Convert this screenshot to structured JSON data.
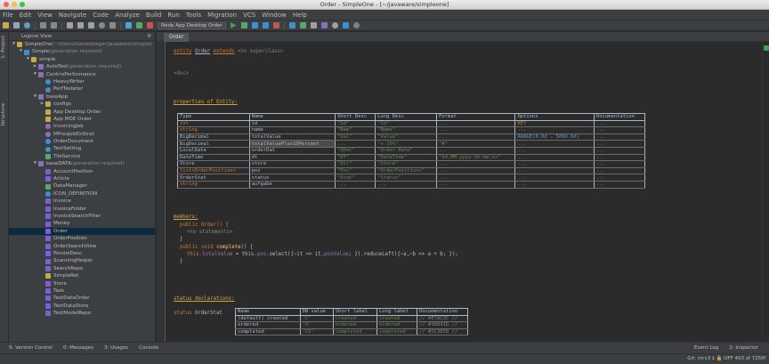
{
  "window": {
    "title": "Order - SimpleOne - [~/javaware/simpleone]"
  },
  "menu": [
    "File",
    "Edit",
    "View",
    "Navigate",
    "Code",
    "Analyze",
    "Build",
    "Run",
    "Tools",
    "Migration",
    "VCS",
    "Window",
    "Help"
  ],
  "toolbar": {
    "run_config": "Node App Desktop Order"
  },
  "left_stripe": {
    "project_tab": "1: Project",
    "structure_tab": "Structure"
  },
  "project_panel": {
    "header": "Logical View",
    "tree": [
      {
        "indent": 0,
        "arrow": "▼",
        "icon": "folder",
        "text": "SimpleOne",
        "note": " (~/Users/danielsteger/javaware/simpleo"
      },
      {
        "indent": 1,
        "arrow": "▼",
        "icon": "module",
        "text": "Simple",
        "note": " (generation required)"
      },
      {
        "indent": 2,
        "arrow": "▼",
        "icon": "folder",
        "text": "simple",
        "note": ""
      },
      {
        "indent": 3,
        "arrow": "▶",
        "icon": "pkg",
        "text": "AutoTest",
        "note": " (generation required)"
      },
      {
        "indent": 3,
        "arrow": "▼",
        "icon": "pkg",
        "text": "CentrixPerformance",
        "note": ""
      },
      {
        "indent": 4,
        "arrow": "",
        "icon": "class",
        "text": "HeavyWriter",
        "note": ""
      },
      {
        "indent": 4,
        "arrow": "",
        "icon": "class",
        "text": "PerfTesteter",
        "note": ""
      },
      {
        "indent": 3,
        "arrow": "▼",
        "icon": "pkg",
        "text": "baseApp",
        "note": ""
      },
      {
        "indent": 4,
        "arrow": "▶",
        "icon": "folder",
        "text": "configs",
        "note": ""
      },
      {
        "indent": 4,
        "arrow": "",
        "icon": "app",
        "text": "App Desktop Order",
        "note": ""
      },
      {
        "indent": 4,
        "arrow": "",
        "icon": "app",
        "text": "App MDE Order",
        "note": ""
      },
      {
        "indent": 4,
        "arrow": "",
        "icon": "job",
        "text": "InvoicingJob",
        "note": ""
      },
      {
        "indent": 4,
        "arrow": "",
        "icon": "job",
        "text": "MPresJobExStrat",
        "note": ""
      },
      {
        "indent": 4,
        "arrow": "",
        "icon": "class",
        "text": "OrderDocument",
        "note": ""
      },
      {
        "indent": 4,
        "arrow": "",
        "icon": "class",
        "text": "TextSetting",
        "note": ""
      },
      {
        "indent": 4,
        "arrow": "",
        "icon": "xml",
        "text": "TileService",
        "note": ""
      },
      {
        "indent": 3,
        "arrow": "▼",
        "icon": "pkg",
        "text": "baseDATA",
        "note": " (generation required)"
      },
      {
        "indent": 4,
        "arrow": "",
        "icon": "entity",
        "text": "AccountPosition",
        "note": ""
      },
      {
        "indent": 4,
        "arrow": "",
        "icon": "entity",
        "text": "Article",
        "note": ""
      },
      {
        "indent": 4,
        "arrow": "",
        "icon": "xml",
        "text": "DataManager",
        "note": ""
      },
      {
        "indent": 4,
        "arrow": "",
        "icon": "class",
        "text": "ICON_DEFINITION",
        "note": ""
      },
      {
        "indent": 4,
        "arrow": "",
        "icon": "entity",
        "text": "Invoice",
        "note": ""
      },
      {
        "indent": 4,
        "arrow": "",
        "icon": "entity",
        "text": "InvoiceFolder",
        "note": ""
      },
      {
        "indent": 4,
        "arrow": "",
        "icon": "entity",
        "text": "InvoiceSearchFilter",
        "note": ""
      },
      {
        "indent": 4,
        "arrow": "",
        "icon": "entity",
        "text": "Money",
        "note": ""
      },
      {
        "indent": 4,
        "arrow": "",
        "icon": "entity",
        "text": "Order",
        "note": "",
        "selected": true
      },
      {
        "indent": 4,
        "arrow": "",
        "icon": "entity",
        "text": "OrderPosition",
        "note": ""
      },
      {
        "indent": 4,
        "arrow": "",
        "icon": "entity",
        "text": "OrderSearchView",
        "note": ""
      },
      {
        "indent": 4,
        "arrow": "",
        "icon": "entity",
        "text": "PersistDesc",
        "note": ""
      },
      {
        "indent": 4,
        "arrow": "",
        "icon": "entity",
        "text": "ScanningHelper",
        "note": ""
      },
      {
        "indent": 4,
        "arrow": "",
        "icon": "entity",
        "text": "SearchRepo",
        "note": ""
      },
      {
        "indent": 4,
        "arrow": "",
        "icon": "folder",
        "text": "SimpleRet",
        "note": ""
      },
      {
        "indent": 4,
        "arrow": "",
        "icon": "entity",
        "text": "Store",
        "note": ""
      },
      {
        "indent": 4,
        "arrow": "",
        "icon": "entity",
        "text": "Task",
        "note": ""
      },
      {
        "indent": 4,
        "arrow": "",
        "icon": "entity",
        "text": "TextDataOrder",
        "note": ""
      },
      {
        "indent": 4,
        "arrow": "",
        "icon": "entity",
        "text": "TextDataStore",
        "note": ""
      },
      {
        "indent": 4,
        "arrow": "",
        "icon": "entity",
        "text": "TextModelRepo",
        "note": ""
      }
    ]
  },
  "editor": {
    "tab": "Order",
    "entity_line": {
      "kw": "entity",
      "name": "Order",
      "extends": "extends",
      "super": "<no superclass>"
    },
    "doc": "<doc>",
    "props_header": "properties of Entity:",
    "props_table": {
      "headers": [
        "Type",
        "Name",
        "Short Desc",
        "Long Desc",
        "Format",
        "Options",
        "Documentation"
      ],
      "rows": [
        [
          "int",
          "id",
          "\"Id\"",
          "\"Id\"",
          "...",
          "KEY",
          "..."
        ],
        [
          "string",
          "name",
          "\"Nam\"",
          "\"Name\"",
          "...",
          "...",
          "..."
        ],
        [
          "BigDecimal",
          "totalValue",
          "\"Val\"",
          "\"Value\"",
          "...",
          "RANGE(0.0d - 5000.0d)",
          "..."
        ],
        [
          "BigDecimal",
          "totalValuePlus10Percent",
          "...",
          "\"+ 10%\"",
          "\"#\"",
          "...",
          "..."
        ],
        [
          "LocalDate",
          "orderDat",
          "\"ODat\"",
          "\"Order Date\"",
          "...",
          "...",
          "..."
        ],
        [
          "DateTime",
          "dt",
          "\"DT\"",
          "\"DateTime\"",
          "\"dd.MM.yyyy hh:mm:ss\"",
          "...",
          "..."
        ],
        [
          "Store",
          "store",
          "\"Str\"",
          "\"Store\"",
          "...",
          "...",
          "..."
        ],
        [
          "list<OrderPosition>",
          "pos",
          "\"Pos\"",
          "\"OrderPositions\"",
          "...",
          "...",
          "..."
        ],
        [
          "OrderStat",
          "status",
          "\"Stat\"",
          "\"Status\"",
          "...",
          "...",
          "..."
        ],
        [
          "string",
          "aufgabe",
          "...",
          "...",
          "...",
          "...",
          "..."
        ]
      ]
    },
    "members_header": "members:",
    "code": {
      "l1": "public Order() {",
      "l2": "<no statements>",
      "l3": "}",
      "l4a": "public void ",
      "l4b": "complete",
      "l4c": "() {",
      "l5a": "this.",
      "l5b": "totalValue",
      "l5c": " = this.",
      "l5d": "pos",
      "l5e": ".select({~it => it.",
      "l5f": "posValue",
      "l5g": "; }).reduceLeft({~a,~b => a + b; });",
      "l6": "}"
    },
    "status_header": "status declarations:",
    "status_kw": "status",
    "status_name": "OrderStat",
    "status_table": {
      "headers": [
        "Name",
        "DB value",
        "Short label",
        "Long label",
        "Documentation"
      ],
      "rows": [
        [
          "(default) created",
          "'C'",
          "created",
          "created",
          "// #E7AC3C //"
        ],
        [
          "ordered",
          "'O'",
          "ordered",
          "ordered",
          "// #3B841D //"
        ],
        [
          "completed",
          "'CO'",
          "completed",
          "completed",
          "// #2C3E50 //"
        ]
      ]
    }
  },
  "bottom_tools": [
    "9: Version Control",
    "0: Messages",
    "3: Usages",
    "Console"
  ],
  "bottom_right": [
    "Event Log",
    "2: Inspector"
  ],
  "status": {
    "right": "Git: mrv3 ‡   🔒 OFF   403 of 725M"
  }
}
